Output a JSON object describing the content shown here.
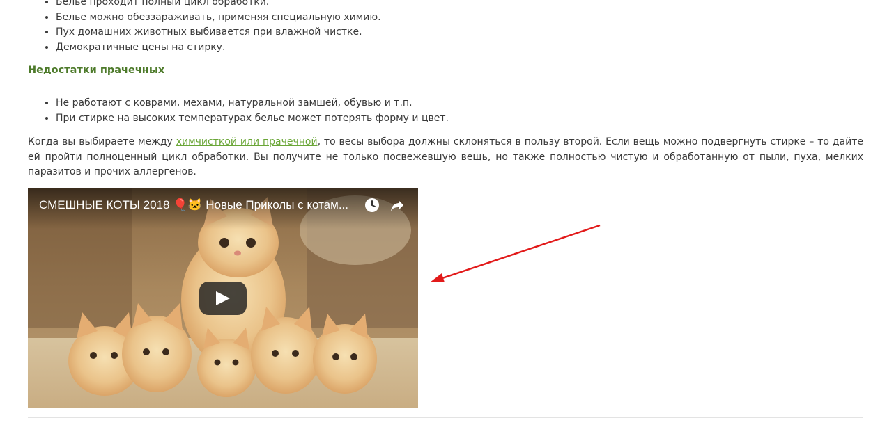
{
  "advantages": [
    "Белье проходит полный цикл обработки.",
    "Белье можно обеззараживать, применяя специальную химию.",
    "Пух домашних животных выбивается при влажной чистке.",
    "Демократичные цены на стирку."
  ],
  "cons_heading": "Недостатки прачечных",
  "cons": [
    "Не работают с коврами, мехами, натуральной замшей, обувью и т.п.",
    "При стирке на высоких температурах белье может потерять форму и цвет."
  ],
  "paragraph": {
    "before_link": "Когда вы выбираете между ",
    "link_text": "химчисткой или прачечной",
    "after_link": ", то весы выбора должны склоняться в пользу второй. Если вещь можно подвергнуть стирке – то дайте ей пройти полноценный цикл обработки. Вы получите не только посвежевшую вещь, но также полностью чистую и обработанную от пыли, пуха, мелких паразитов и прочих аллергенов."
  },
  "video": {
    "title": "СМЕШНЫЕ КОТЫ 2018 🎈🐱 Новые Приколы с котам...",
    "icons": [
      "clock-icon",
      "share-icon",
      "play-icon"
    ]
  },
  "colors": {
    "heading_green": "#4d7a2a",
    "link_green": "#6aa637",
    "annotation_red": "#e21a1a",
    "youtube_play_bg": "#212121"
  }
}
